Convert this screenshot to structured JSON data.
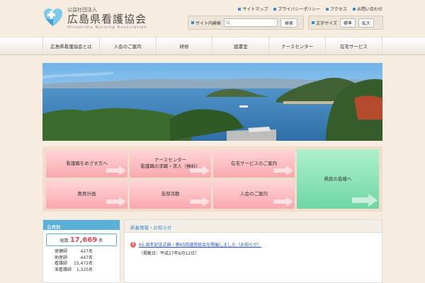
{
  "header": {
    "org_type": "公益社団法人",
    "org_name": "広島県看護協会",
    "org_name_en": "Hiroshima Nursing Association",
    "top_links": [
      "サイトマップ",
      "プライバシーポリシー",
      "アクセス",
      "お問い合わせ"
    ],
    "search": {
      "label": "サイト内検索",
      "placeholder": "",
      "button": "検索"
    },
    "font_size": {
      "label": "文字サイズ",
      "normal": "標準",
      "large": "拡大"
    }
  },
  "nav": {
    "items": [
      "広島県看護協会とは",
      "入会のご案内",
      "研修",
      "図書室",
      "ナースセンター",
      "在宅サービス"
    ]
  },
  "tiles": {
    "nursing_career": "看護職をめざす方へ",
    "nurse_center_line1": "ナースセンター",
    "nurse_center_line2": "看護職の求職・求人（無料）",
    "home_service": "在宅サービスのご案内",
    "citizens": "県民の皆様へ",
    "education_plan": "教育計画",
    "branch": "支部活動",
    "membership": "入会のご案内"
  },
  "members": {
    "header": "会員数",
    "total_label": "総数",
    "total_value": "17,669",
    "unit": "名",
    "rows": [
      {
        "label": "保健師",
        "value": "427名"
      },
      {
        "label": "助産師",
        "value": "447名"
      },
      {
        "label": "看護師",
        "value": "15,472名"
      },
      {
        "label": "准看護師",
        "value": "1,325名"
      }
    ]
  },
  "news": {
    "header": "新着情報・お知らせ",
    "item_title": "65.周年記念式典・第65回通常総会を開催しました（お知らせ）",
    "item_date": "（掲載日：平成27年6月12日）"
  },
  "colors": {
    "accent_blue": "#5bb0d8",
    "tile_pink": "#f9a8ad",
    "tile_green": "#6ed6a3",
    "count_red": "#e2445a"
  }
}
